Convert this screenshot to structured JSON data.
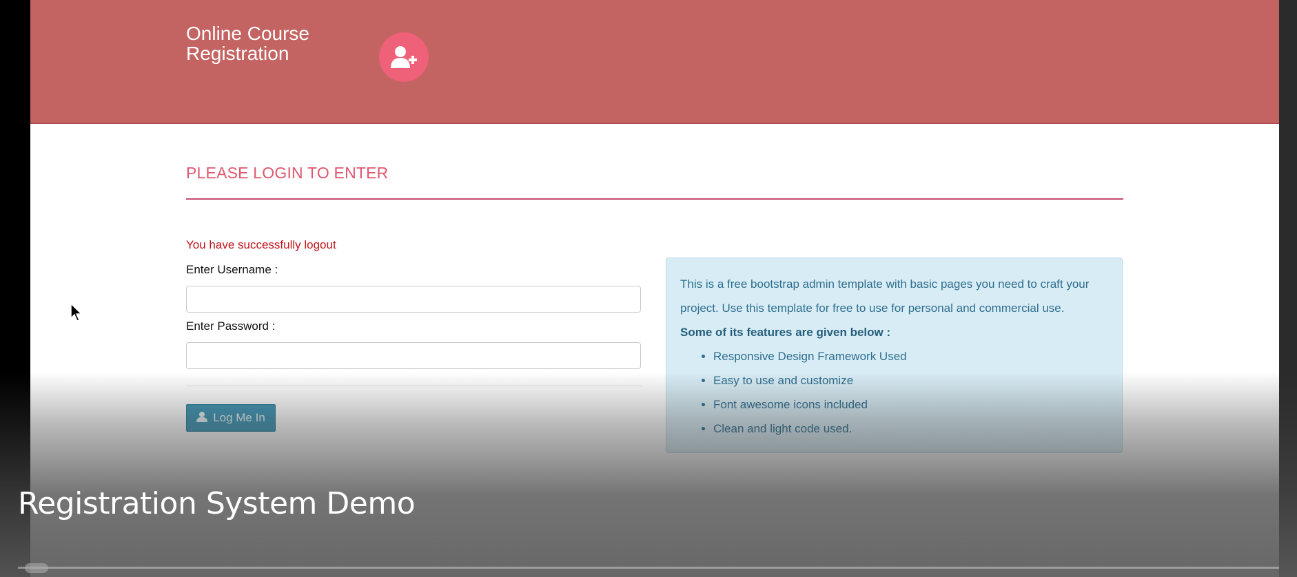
{
  "header": {
    "brand_line1": "Online Course",
    "brand_line2": "Registration",
    "logo_icon": "user-plus-icon"
  },
  "login": {
    "heading": "PLEASE LOGIN TO ENTER",
    "status_message": "You have successfully logout",
    "username_label": "Enter Username :",
    "username_value": "",
    "password_label": "Enter Password :",
    "password_value": "",
    "button_label": "Log Me In",
    "button_icon": "user-icon"
  },
  "info": {
    "intro": "This is a free bootstrap admin template with basic pages you need to craft your project. Use this template for free to use for personal and commercial use.",
    "features_title": "Some of its features are given below :",
    "features": [
      "Responsive Design Framework Used",
      "Easy to use and customize",
      "Font awesome icons included",
      "Clean and light code used."
    ]
  },
  "video": {
    "title": "Registration System Demo"
  },
  "colors": {
    "header_bg": "#c46462",
    "accent": "#e0576e",
    "button_bg": "#3d95b4",
    "info_bg": "#d8ecf5",
    "status_text": "#c0141b"
  }
}
